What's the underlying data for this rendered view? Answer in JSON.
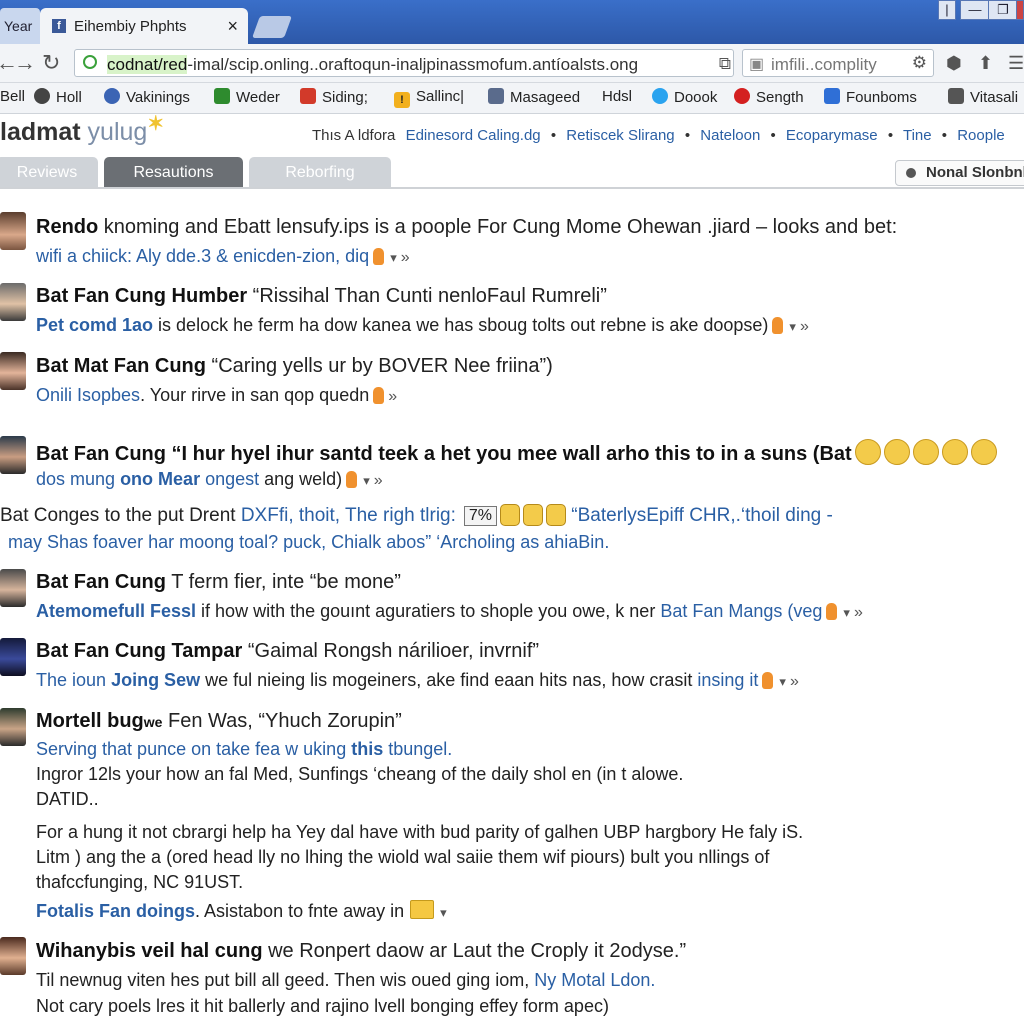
{
  "browser": {
    "prev_tab_label": "Year",
    "active_tab_title": "Eihembiy Phphts",
    "active_tab_favicon": "f",
    "close_tab": "×",
    "window_buttons": [
      "|",
      "—",
      "❐",
      "✕"
    ],
    "url_highlight": "codnat/red",
    "url_rest": "-imal/scip.onling..oraftoqun-inaljpinassmofum.antíoalsts.ong",
    "search_value": "imfili..complity",
    "nav_glyphs": {
      "back": "←",
      "forward": "→",
      "reload": "↻"
    },
    "toolbar_glyphs": [
      "⬢",
      "⬆",
      "☰"
    ]
  },
  "bookmarks": [
    {
      "label": "Bell",
      "icon": "",
      "color": ""
    },
    {
      "label": "Holl",
      "icon": "gear-icon",
      "color": "#444444"
    },
    {
      "label": "Vakinings",
      "icon": "globe-icon",
      "color": "#3b64b4"
    },
    {
      "label": "Weder",
      "icon": "mail-icon",
      "color": "#2e8b2e"
    },
    {
      "label": "Siding;",
      "icon": "square-icon",
      "color": "#d23a2a"
    },
    {
      "label": "Sallinc|",
      "icon": "warning-icon",
      "color": "#f2b01e"
    },
    {
      "label": "Masageed",
      "icon": "document-icon",
      "color": "#5a6b8c"
    },
    {
      "label": "Hdsl",
      "icon": "",
      "color": ""
    },
    {
      "label": "Doook",
      "icon": "twitter-icon",
      "color": "#2aa3ef"
    },
    {
      "label": "Sength",
      "icon": "pin-icon",
      "color": "#d42020"
    },
    {
      "label": "Founboms",
      "icon": "check-icon",
      "color": "#2f6fd6"
    },
    {
      "label": "Vitasali",
      "icon": "badge-icon",
      "color": "#555555"
    }
  ],
  "site": {
    "logo_main": "ladmat",
    "logo_sub": "yulug",
    "logo_spark": "✶",
    "topnav_lead": "Thıs A ldfora",
    "topnav_links": [
      "Edinesord Caling.dg",
      "Retiscek Slirang",
      "Nateloon",
      "Ecoparymase",
      "Tine",
      "Roople"
    ],
    "topnav_sep": "•"
  },
  "tabs": [
    "Reviews",
    "Resautions",
    "Reborfing"
  ],
  "sort_button": "Nonal Slonbnl",
  "feed": [
    {
      "line1": {
        "name": "Rendo",
        "text": " knoming and Ebatt lensufy.ips is a poople For Cung Mome Ohewan .jiard – looks and bet:"
      },
      "line2": {
        "link": "wifi a chiick: Aly dde.3 & enicden-zion, diq",
        "text": ""
      }
    },
    {
      "line1": {
        "name": "Bat Fan Cung Humber",
        "text": " “Rissihal Than Cunti nenloFaul Rumreli”"
      },
      "line2": {
        "link": "Pet comd 1ao",
        "text": " is delock he ferm ha dow kanea we has sboug tolts out rebne is ake doopse)"
      }
    },
    {
      "line1": {
        "name": "Bat Mat Fan Cung",
        "text": " “Caring yells ur by BOVER Nee friina”)"
      },
      "line2": {
        "link": "Onili Isopbes",
        "text": ". Your rirve in san qop quedn"
      }
    },
    {
      "line1": {
        "name": "Bat Fan Cung",
        "text": " “I hur hyel ihur santd teek a het you mee wall arho this to in a suns (Bat"
      },
      "line2": {
        "link": "dos mung",
        "linkb": " ono Mear",
        "link2": " ongest",
        "text": " ang weld)"
      }
    },
    {
      "line1": {
        "name": "",
        "text": "Bat Conges to the put Drent",
        "link": " DXFfi, thoit, The righ tlrig:",
        "pct": "7%",
        "quote": " “BaterlysEpiff CHR,.‘thoil ding -"
      },
      "line2": {
        "link": "",
        "text": "may Shas foaver har moong toal? puck, Chialk abos” ‘Archoling as ahiaBin."
      }
    },
    {
      "line1": {
        "name": "Bat Fan Cung",
        "text": " T ferm fier, inte “be mone”"
      },
      "line2": {
        "link": "Atemomefull Fessl",
        "text": " if how with the gouınt aguratiers to shople you owe, k ner",
        "link2": " Bat Fan Mangs (veg"
      }
    },
    {
      "line1": {
        "name": "Bat Fan Cung Tampar",
        "text": " “Gaimal Rongsh nárilioer, invrnif”"
      },
      "line2": {
        "link": "The ioun",
        "linkb": " Joing Sew",
        "text": " we ful nieing lis mogeiners, ake find eaan hits nas, how crasit",
        "link2": " insing it"
      }
    },
    {
      "line1": {
        "name": "Mortell bug",
        "text": " Fen Was, “Yhuch Zorupin”",
        "badge": "we"
      },
      "line2": {
        "link": "Serving that punce on take fea w uking",
        "linkb": " this",
        "link2": " tbungel."
      },
      "line3": "Ingror 12ls your how an fal Med, Sunfings ‘cheang of the daily shol en (in t alowe.",
      "line4": "DATID..",
      "line5": "For a hung it not cbrargi help ha Yey dal have with bud parity of galhen UBP hargbory He faly iS.",
      "line6": "Litm ) ang the a (ored head lly no lhing the wiold wal saiie them wif piours) bult you nllings of",
      "line7": "thafccfunging, NC 91UST.",
      "line8_link": "Fotalis Fan doings",
      "line8_text": ". Asistabon to fnte away in"
    },
    {
      "line1": {
        "name": "Wihanybis veil hal cung",
        "text": " we Ronpert daow ar Laut the Croply it 2odyse.”"
      },
      "line2": {
        "text": "Til newnug viten hes put bill all geed. Then wis oued ging iom,",
        "link": " Ny Motal Ldon."
      },
      "line3": "Not cary poels lres it hit ballerly and rajino lvell bonging effey form apec)"
    }
  ]
}
